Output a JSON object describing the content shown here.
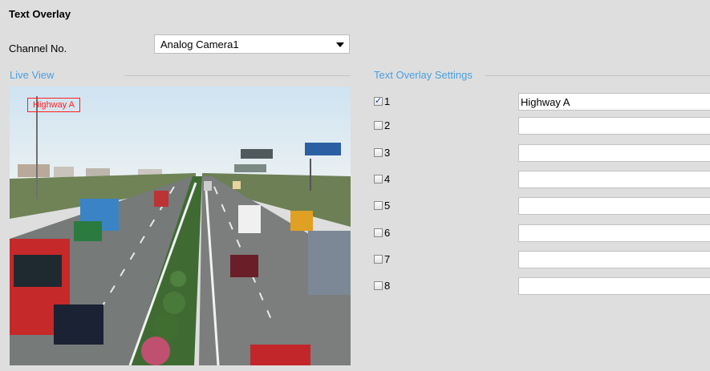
{
  "page": {
    "title": "Text Overlay"
  },
  "channel": {
    "label": "Channel No.",
    "selected": "Analog Camera1"
  },
  "live_view": {
    "title": "Live View",
    "osd_text": "Highway A"
  },
  "settings": {
    "title": "Text Overlay Settings",
    "rows": [
      {
        "number": "1",
        "checked": true,
        "text": "Highway A"
      },
      {
        "number": "2",
        "checked": false,
        "text": ""
      },
      {
        "number": "3",
        "checked": false,
        "text": ""
      },
      {
        "number": "4",
        "checked": false,
        "text": ""
      },
      {
        "number": "5",
        "checked": false,
        "text": ""
      },
      {
        "number": "6",
        "checked": false,
        "text": ""
      },
      {
        "number": "7",
        "checked": false,
        "text": ""
      },
      {
        "number": "8",
        "checked": false,
        "text": ""
      }
    ]
  },
  "colors": {
    "accent": "#4a9fe0",
    "background": "#dedede",
    "osd": "#ff2020"
  },
  "icons": {
    "dropdown": "dropdown-arrow-icon",
    "checkbox": "checkbox-icon"
  }
}
